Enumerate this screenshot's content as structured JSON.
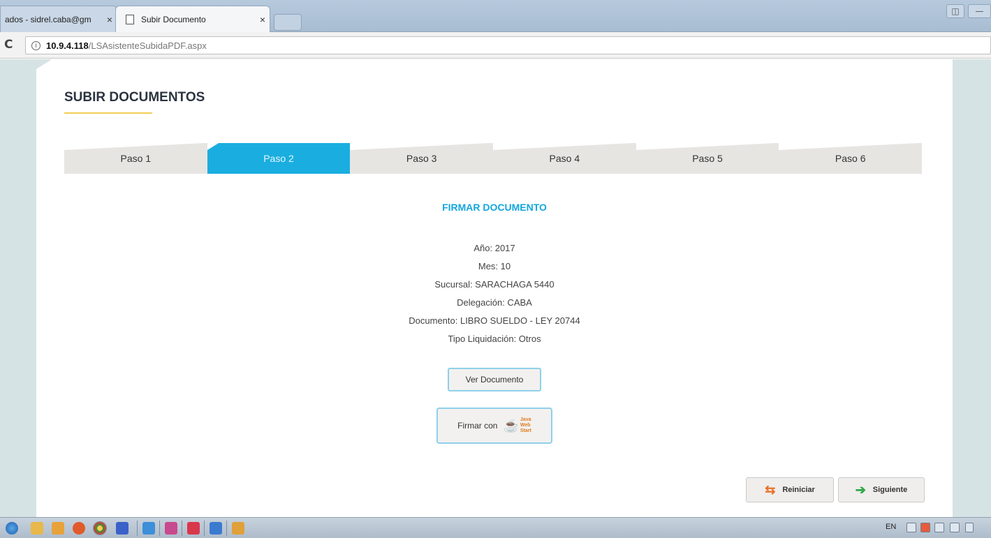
{
  "browser": {
    "tabs": [
      {
        "title": "ados - sidrel.caba@gm",
        "close": "×"
      },
      {
        "title": "Subir Documento",
        "close": "×"
      }
    ],
    "url_host": "10.9.4.118",
    "url_path": "/LSAsistenteSubidaPDF.aspx",
    "reload_glyph": "C",
    "info_glyph": "i"
  },
  "page": {
    "title": "SUBIR DOCUMENTOS",
    "steps": [
      "Paso 1",
      "Paso 2",
      "Paso 3",
      "Paso 4",
      "Paso 5",
      "Paso 6"
    ],
    "active_step": "Paso 2",
    "section_title": "FIRMAR DOCUMENTO",
    "info": [
      "Año: 2017",
      "Mes: 10",
      "Sucursal: SARACHAGA 5440",
      "Delegación: CABA",
      "Documento: LIBRO SUELDO - LEY 20744",
      "Tipo Liquidación: Otros"
    ],
    "ver_documento_label": "Ver Documento",
    "firmar_label": "Firmar con",
    "java_logo_text": [
      "Java",
      "Web",
      "Start"
    ],
    "reiniciar_label": "Reiniciar",
    "siguiente_label": "Siguiente"
  },
  "taskbar": {
    "language": "EN"
  },
  "colors": {
    "accent": "#1aaee0",
    "title_underline": "#f2cf55",
    "viewport_bg": "#d6e3e4"
  }
}
